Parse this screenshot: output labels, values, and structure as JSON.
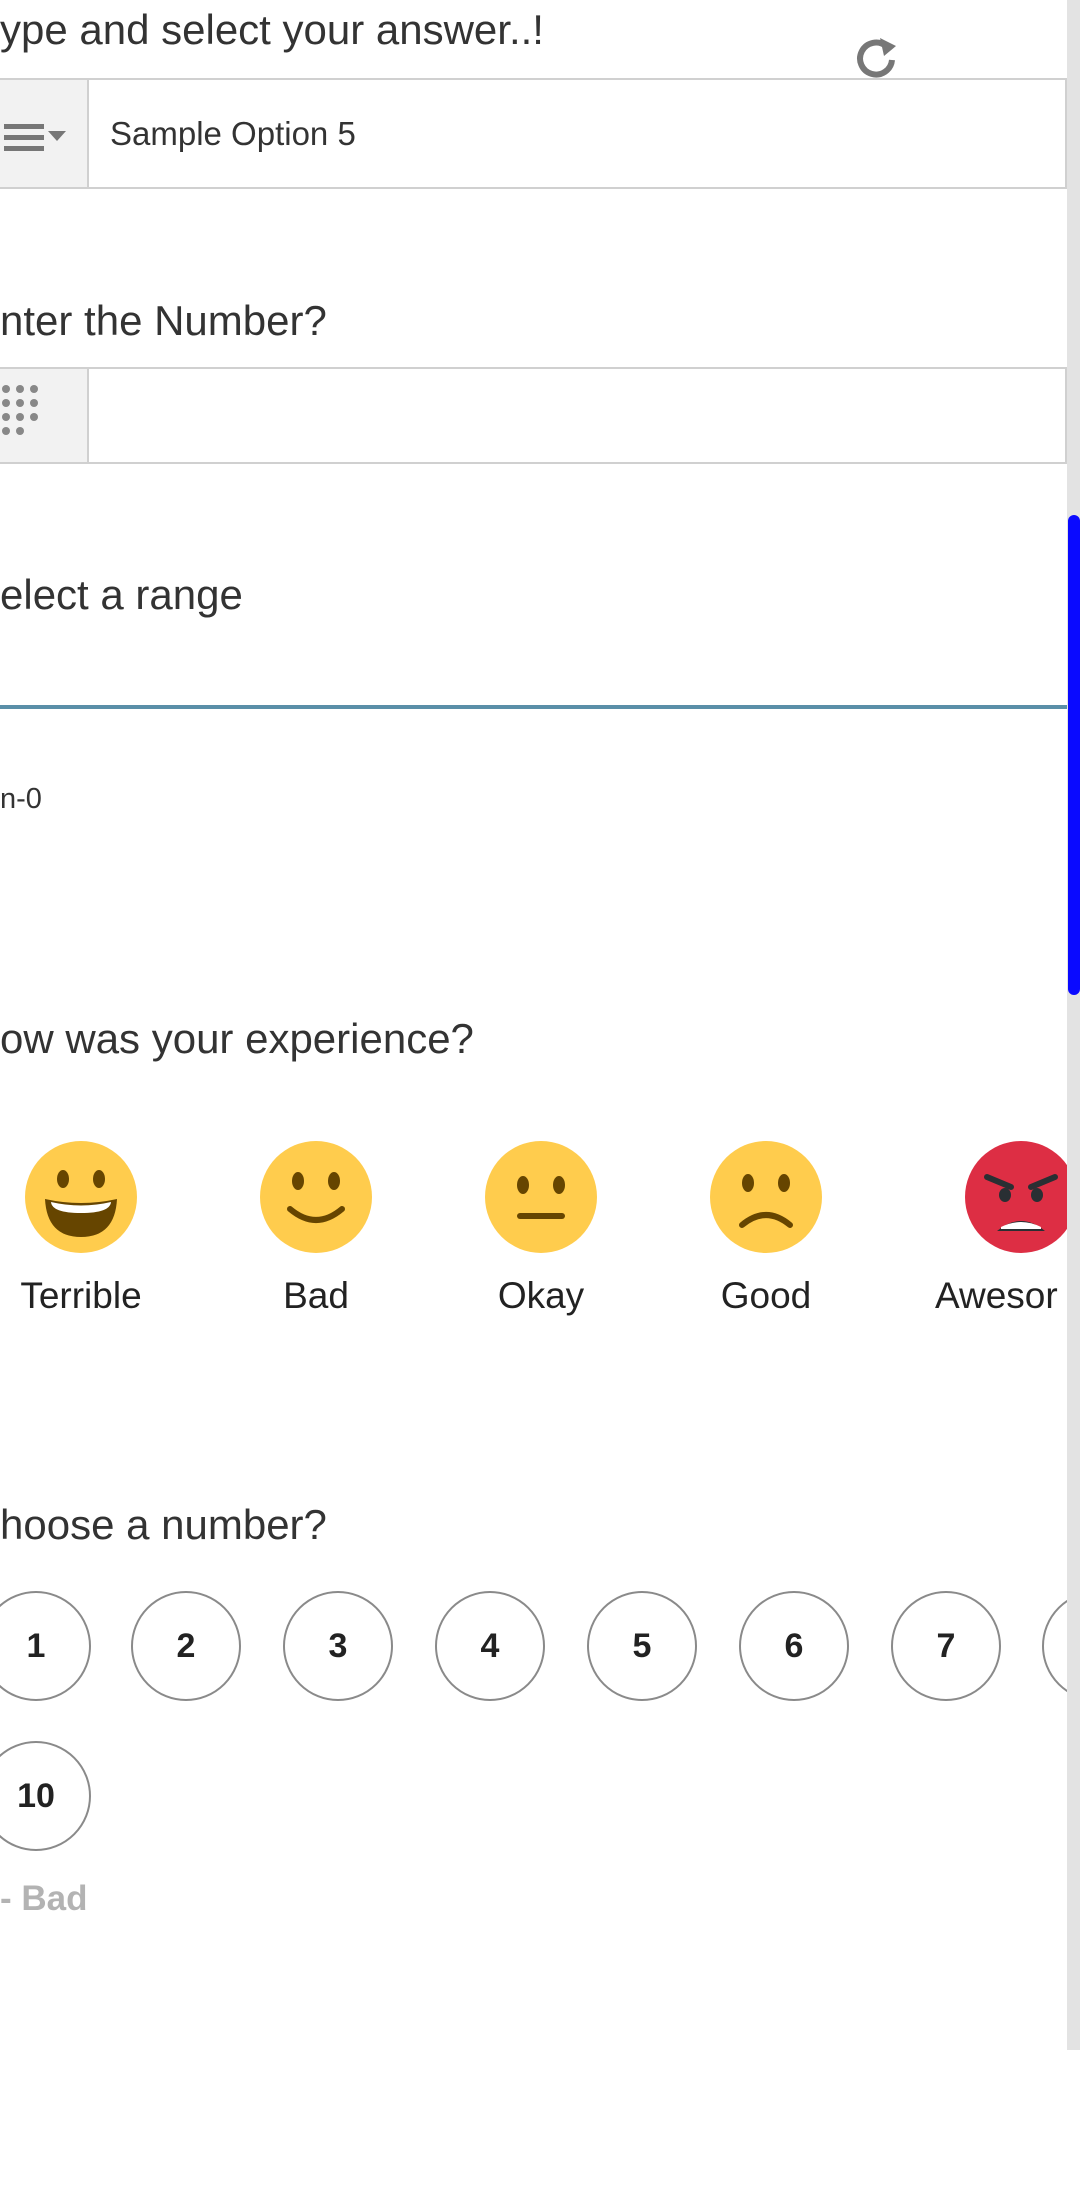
{
  "q1": {
    "label": "ype and select your answer..!",
    "value": "Sample Option 5",
    "icon": "list-dropdown-icon",
    "refresh_icon": "refresh-icon"
  },
  "q2": {
    "label": "nter the Number?",
    "value": "",
    "icon": "keypad-icon"
  },
  "q3": {
    "label": "elect a range",
    "min_label": "n-0"
  },
  "q4": {
    "label": "ow was your experience?",
    "options": [
      {
        "label": "Terrible",
        "icon": "grinning-face-icon"
      },
      {
        "label": "Bad",
        "icon": "slightly-smiling-face-icon"
      },
      {
        "label": "Okay",
        "icon": "neutral-face-icon"
      },
      {
        "label": "Good",
        "icon": "frowning-face-icon"
      },
      {
        "label": "Awesor",
        "icon": "angry-face-icon"
      }
    ]
  },
  "q5": {
    "label": "hoose a number?",
    "numbers": [
      "1",
      "2",
      "3",
      "4",
      "5",
      "6",
      "7",
      "10"
    ],
    "footer": "- Bad"
  },
  "colors": {
    "accent_line": "#5a8fa8",
    "scrollbar": "#0a0aff",
    "emoji_yellow": "#ffcc4d",
    "emoji_red": "#dd2e44"
  }
}
